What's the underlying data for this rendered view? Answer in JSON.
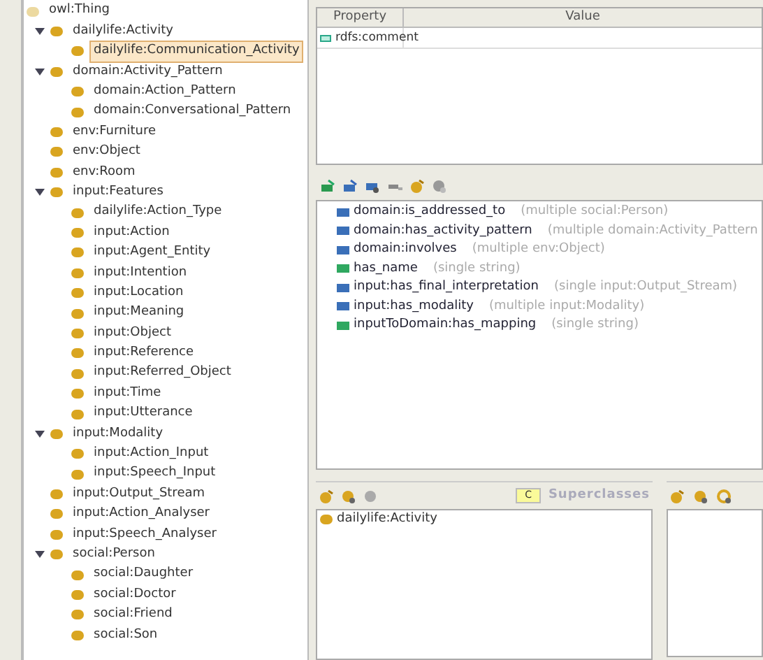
{
  "class_tree": {
    "label": "owl:Thing",
    "selected": false,
    "children": [
      {
        "label": "dailylife:Activity",
        "expanded": true,
        "selected": false,
        "children": [
          {
            "label": "dailylife:Communication_Activity",
            "selected": true
          }
        ]
      },
      {
        "label": "domain:Activity_Pattern",
        "expanded": true,
        "selected": false,
        "children": [
          {
            "label": "domain:Action_Pattern",
            "selected": false
          },
          {
            "label": "domain:Conversational_Pattern",
            "selected": false
          }
        ]
      },
      {
        "label": "env:Furniture",
        "selected": false
      },
      {
        "label": "env:Object",
        "selected": false
      },
      {
        "label": "env:Room",
        "selected": false
      },
      {
        "label": "input:Features",
        "expanded": true,
        "selected": false,
        "children": [
          {
            "label": "dailylife:Action_Type",
            "selected": false
          },
          {
            "label": "input:Action",
            "selected": false
          },
          {
            "label": "input:Agent_Entity",
            "selected": false
          },
          {
            "label": "input:Intention",
            "selected": false
          },
          {
            "label": "input:Location",
            "selected": false
          },
          {
            "label": "input:Meaning",
            "selected": false
          },
          {
            "label": "input:Object",
            "selected": false
          },
          {
            "label": "input:Reference",
            "selected": false
          },
          {
            "label": "input:Referred_Object",
            "selected": false
          },
          {
            "label": "input:Time",
            "selected": false
          },
          {
            "label": "input:Utterance",
            "selected": false
          }
        ]
      },
      {
        "label": "input:Modality",
        "expanded": true,
        "selected": false,
        "children": [
          {
            "label": "input:Action_Input",
            "selected": false
          },
          {
            "label": "input:Speech_Input",
            "selected": false
          }
        ]
      },
      {
        "label": "input:Output_Stream",
        "selected": false
      },
      {
        "label": "input:Action_Analyser",
        "selected": false
      },
      {
        "label": "input:Speech_Analyser",
        "selected": false
      },
      {
        "label": "social:Person",
        "expanded": true,
        "selected": false,
        "children": [
          {
            "label": "social:Daughter",
            "selected": false
          },
          {
            "label": "social:Doctor",
            "selected": false
          },
          {
            "label": "social:Friend",
            "selected": false
          },
          {
            "label": "social:Son",
            "selected": false
          }
        ]
      }
    ]
  },
  "annotations": {
    "columns": [
      "Property",
      "Value"
    ],
    "rows": [
      {
        "property": "rdfs:comment"
      }
    ]
  },
  "slots": [
    {
      "name": "domain:is_addressed_to",
      "detail": "(multiple social:Person)",
      "color": "#3a6fb8"
    },
    {
      "name": "domain:has_activity_pattern",
      "detail": "(multiple domain:Activity_Pattern",
      "color": "#3a6fb8"
    },
    {
      "name": "domain:involves",
      "detail": "(multiple env:Object)",
      "color": "#3a6fb8"
    },
    {
      "name": "has_name",
      "detail": "(single string)",
      "color": "#2fa860"
    },
    {
      "name": "input:has_final_interpretation",
      "detail": "(single input:Output_Stream)",
      "color": "#3a6fb8"
    },
    {
      "name": "input:has_modality",
      "detail": "(multiple input:Modality)",
      "color": "#3a6fb8"
    },
    {
      "name": "inputToDomain:has_mapping",
      "detail": "(single string)",
      "color": "#2fa860"
    }
  ],
  "superclasses": {
    "badge": "C",
    "title": "Superclasses",
    "items": [
      "dailylife:Activity"
    ]
  }
}
